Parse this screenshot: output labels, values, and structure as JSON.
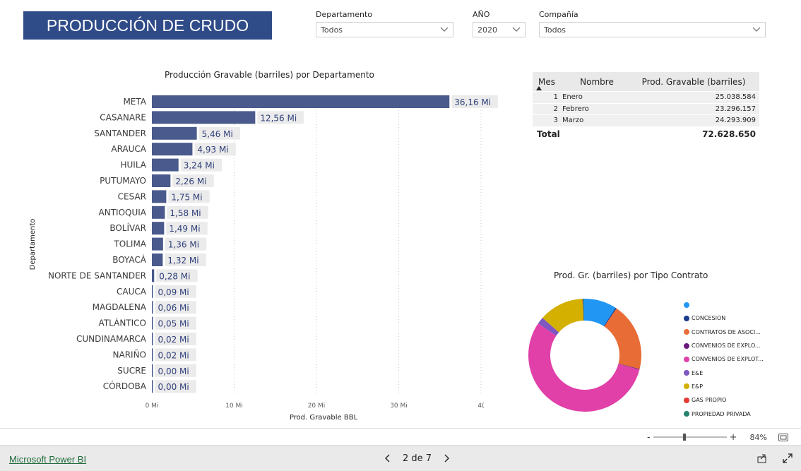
{
  "report_title": "PRODUCCIÓN DE CRUDO",
  "filters": {
    "departamento": {
      "label": "Departamento",
      "value": "Todos"
    },
    "anio": {
      "label": "AÑO",
      "value": "2020"
    },
    "compania": {
      "label": "Compañía",
      "value": "Todos"
    }
  },
  "chart_data": [
    {
      "type": "bar",
      "orientation": "horizontal",
      "title": "Producción Gravable (barriles) por Departamento",
      "xlabel": "Prod. Gravable BBL",
      "ylabel": "Departamento",
      "xlim": [
        0,
        40
      ],
      "x_ticks": [
        "0 Mi",
        "10 Mi",
        "20 Mi",
        "30 Mi",
        "4("
      ],
      "categories": [
        "META",
        "CASANARE",
        "SANTANDER",
        "ARAUCA",
        "HUILA",
        "PUTUMAYO",
        "CESAR",
        "ANTIOQUIA",
        "BOLÍVAR",
        "TOLIMA",
        "BOYACÁ",
        "NORTE DE SANTANDER",
        "CAUCA",
        "MAGDALENA",
        "ATLÁNTICO",
        "CUNDINAMARCA",
        "NARIÑO",
        "SUCRE",
        "CÓRDOBA"
      ],
      "values": [
        36.16,
        12.56,
        5.46,
        4.93,
        3.24,
        2.26,
        1.75,
        1.58,
        1.49,
        1.36,
        1.32,
        0.28,
        0.09,
        0.06,
        0.05,
        0.02,
        0.02,
        0.0,
        0.0
      ],
      "data_labels": [
        "36,16 Mi",
        "12,56 Mi",
        "5,46 Mi",
        "4,93 Mi",
        "3,24 Mi",
        "2,26 Mi",
        "1,75 Mi",
        "1,58 Mi",
        "1,49 Mi",
        "1,36 Mi",
        "1,32 Mi",
        "0,28 Mi",
        "0,09 Mi",
        "0,06 Mi",
        "0,05 Mi",
        "0,02 Mi",
        "0,02 Mi",
        "0,00 Mi",
        "0,00 Mi"
      ],
      "bar_color": "#4a5a8c",
      "grid": true
    },
    {
      "type": "pie",
      "variant": "donut",
      "title": "Prod. Gr. (barriles) por Tipo Contrato",
      "legend_position": "right",
      "slices": [
        {
          "label": "",
          "value": 9.5,
          "color": "#2196f3"
        },
        {
          "label": "CONCESION",
          "value": 0.3,
          "color": "#1a3a8c"
        },
        {
          "label": "CONTRATOS DE ASOCI...",
          "value": 19.5,
          "color": "#e86c35"
        },
        {
          "label": "CONVENIOS DE EXPLO...",
          "value": 0.2,
          "color": "#6a1b7a"
        },
        {
          "label": "CONVENIOS DE EXPLOT...",
          "value": 55.5,
          "color": "#e040a8"
        },
        {
          "label": "E&E",
          "value": 2.0,
          "color": "#7e57c2"
        },
        {
          "label": "E&P",
          "value": 12.8,
          "color": "#d4b000"
        },
        {
          "label": "GAS PROPIO",
          "value": 0.1,
          "color": "#e53935"
        },
        {
          "label": "PROPIEDAD PRIVADA",
          "value": 0.3,
          "color": "#26806e"
        }
      ]
    }
  ],
  "matrix": {
    "headers": {
      "mes": "Mes",
      "nombre": "Nombre",
      "valor": "Prod. Gravable (barriles)"
    },
    "rows": [
      {
        "mes": "1",
        "nombre": "Enero",
        "valor": "25.038.584"
      },
      {
        "mes": "2",
        "nombre": "Febrero",
        "valor": "23.296.157"
      },
      {
        "mes": "3",
        "nombre": "Marzo",
        "valor": "24.293.909"
      }
    ],
    "total": {
      "label": "Total",
      "valor": "72.628.650"
    }
  },
  "zoom": {
    "minus": "-",
    "plus": "+",
    "percent": "84%",
    "level": 0.84
  },
  "footer": {
    "brand_link": "Microsoft Power BI",
    "page_indicator": "2 de 7"
  },
  "icons": {
    "prev": "chevron-left-icon",
    "next": "chevron-right-icon",
    "share": "share-icon",
    "fullscreen": "fullscreen-icon",
    "fit": "fit-to-page-icon"
  }
}
